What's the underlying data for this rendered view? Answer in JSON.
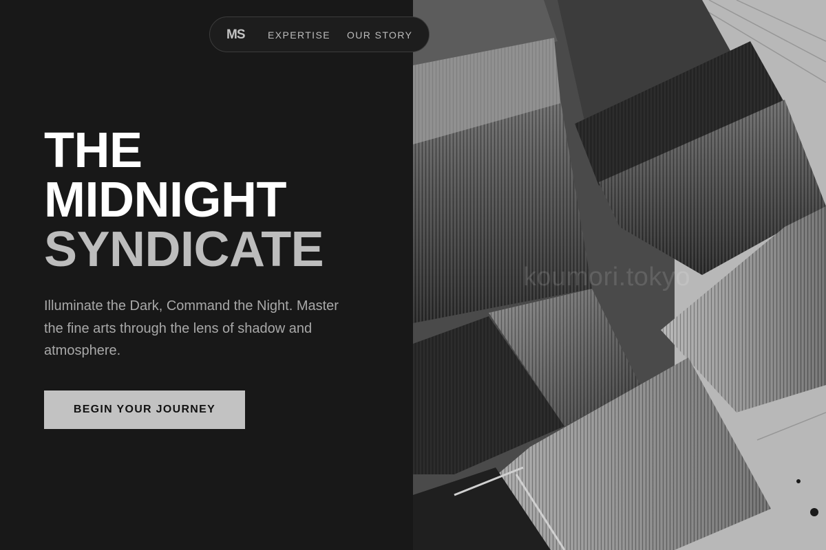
{
  "nav": {
    "logo": "MS",
    "links": [
      {
        "label": "EXPERTISE"
      },
      {
        "label": "OUR STORY"
      }
    ]
  },
  "hero": {
    "title_line1": "THE",
    "title_line2": "MIDNIGHT",
    "title_line3": "SYNDICATE",
    "subtitle": "Illuminate the Dark, Command the Night. Master the fine arts through the lens of shadow and atmosphere.",
    "cta_label": "BEGIN YOUR JOURNEY"
  },
  "image": {
    "subject": "weathered paint brushes, black and white",
    "watermark": "koumori.tokyo"
  },
  "colors": {
    "background": "#181818",
    "title": "#ffffff",
    "title_accent": "#bdbdbd",
    "body_text": "#a9a9a9",
    "cta_background": "#c2c2c2",
    "cta_text": "#111111"
  }
}
